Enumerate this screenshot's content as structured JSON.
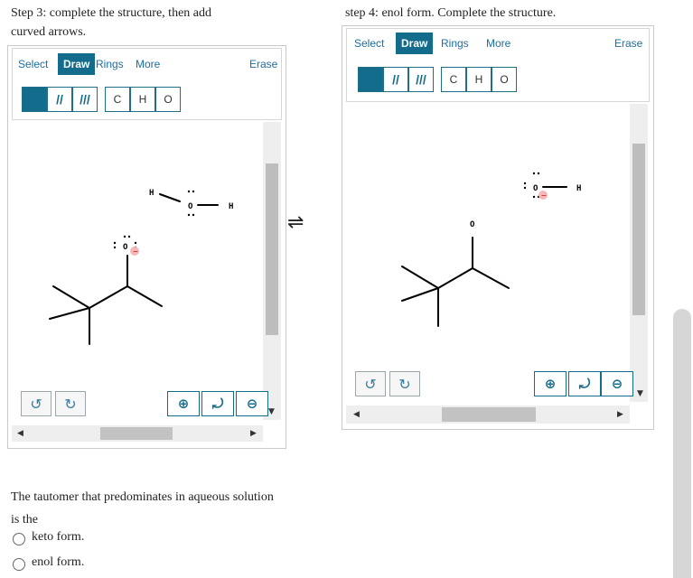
{
  "step3": {
    "instruction_line1": "Step 3: complete the structure, then add",
    "instruction_line2": "curved arrows.",
    "toolbar": {
      "select": "Select",
      "draw": "Draw",
      "rings": "Rings",
      "more": "More",
      "erase": "Erase"
    },
    "atoms": {
      "c": "C",
      "h": "H",
      "o": "O"
    },
    "molecule": {
      "atom_o": "O",
      "h1": "H",
      "o2": "O",
      "h2": "H",
      "charge": "−"
    }
  },
  "step4": {
    "instruction": "step 4: enol form. Complete the structure.",
    "toolbar": {
      "select": "Select",
      "draw": "Draw",
      "rings": "Rings",
      "more": "More",
      "erase": "Erase"
    },
    "atoms": {
      "c": "C",
      "h": "H",
      "o": "O"
    },
    "molecule": {
      "atom_o": "O",
      "o2": "O",
      "h2": "H",
      "charge": "−"
    }
  },
  "equilibrium_symbol": "⇌",
  "question": {
    "line1": "The tautomer that predominates in aqueous solution",
    "line2": "is the",
    "options": [
      "keto form.",
      "enol form."
    ]
  },
  "colors": {
    "accent": "#146c8c",
    "link": "#1a6fa3",
    "charge": "#f4b8b8"
  },
  "icons": [
    "undo-icon",
    "redo-icon",
    "zoom-in-icon",
    "zoom-reset-icon",
    "zoom-out-icon"
  ]
}
